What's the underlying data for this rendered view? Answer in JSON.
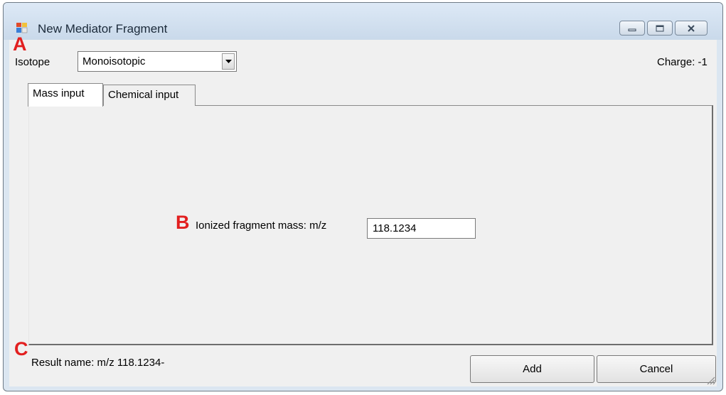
{
  "window": {
    "title": "New Mediator Fragment",
    "icon": "app-window-icon",
    "controls": {
      "minimize": "minimize-icon",
      "maximize": "maximize-icon",
      "close": "close-icon"
    }
  },
  "isotope": {
    "label": "Isotope",
    "selected": "Monoisotopic"
  },
  "charge": "Charge: -1",
  "tabs": [
    {
      "label": "Mass input",
      "active": true
    },
    {
      "label": "Chemical input",
      "active": false
    }
  ],
  "mass_input": {
    "label": "Ionized fragment mass:  m/z",
    "value": "118.1234"
  },
  "result_name": "Result name: m/z 118.1234-",
  "buttons": {
    "add": "Add",
    "cancel": "Cancel"
  },
  "annotations": {
    "a": "A",
    "b": "B",
    "c": "C"
  },
  "colors": {
    "annotation": "#e21f1f",
    "window_bg": "#f0f0f0",
    "titlebar": "#dde9f6"
  }
}
